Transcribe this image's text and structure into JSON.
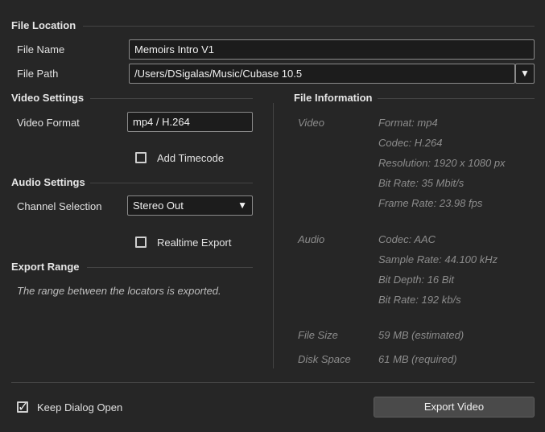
{
  "file_location": {
    "title": "File Location",
    "file_name_label": "File Name",
    "file_name_value": "Memoirs Intro V1",
    "file_path_label": "File Path",
    "file_path_value": "/Users/DSigalas/Music/Cubase 10.5",
    "dropdown_glyph": "▼"
  },
  "video_settings": {
    "title": "Video Settings",
    "format_label": "Video Format",
    "format_value": "mp4 / H.264",
    "timecode_label": "Add Timecode",
    "timecode_checked": false
  },
  "audio_settings": {
    "title": "Audio Settings",
    "channel_label": "Channel Selection",
    "channel_value": "Stereo Out",
    "dropdown_glyph": "▼",
    "realtime_label": "Realtime Export",
    "realtime_checked": false
  },
  "export_range": {
    "title": "Export Range",
    "description": "The range between the locators is exported."
  },
  "file_information": {
    "title": "File Information",
    "video_label": "Video",
    "video_lines": [
      "Format: mp4",
      "Codec: H.264",
      "Resolution: 1920 x 1080 px",
      "Bit Rate: 35 Mbit/s",
      "Frame Rate: 23.98 fps"
    ],
    "audio_label": "Audio",
    "audio_lines": [
      "Codec: AAC",
      "Sample Rate: 44.100 kHz",
      "Bit Depth: 16 Bit",
      "Bit Rate: 192 kb/s"
    ],
    "file_size_label": "File Size",
    "file_size_value": "59 MB (estimated)",
    "disk_space_label": "Disk Space",
    "disk_space_value": "61 MB (required)"
  },
  "footer": {
    "keep_open_label": "Keep Dialog Open",
    "keep_open_checked": true,
    "checkmark_glyph": "✓",
    "export_button_label": "Export Video"
  },
  "colors": {
    "background": "#262626",
    "field_background": "#1c1c1c",
    "field_border": "#8a8a8a",
    "muted_text": "#8c8c8c",
    "button": "#4a4a4a"
  }
}
